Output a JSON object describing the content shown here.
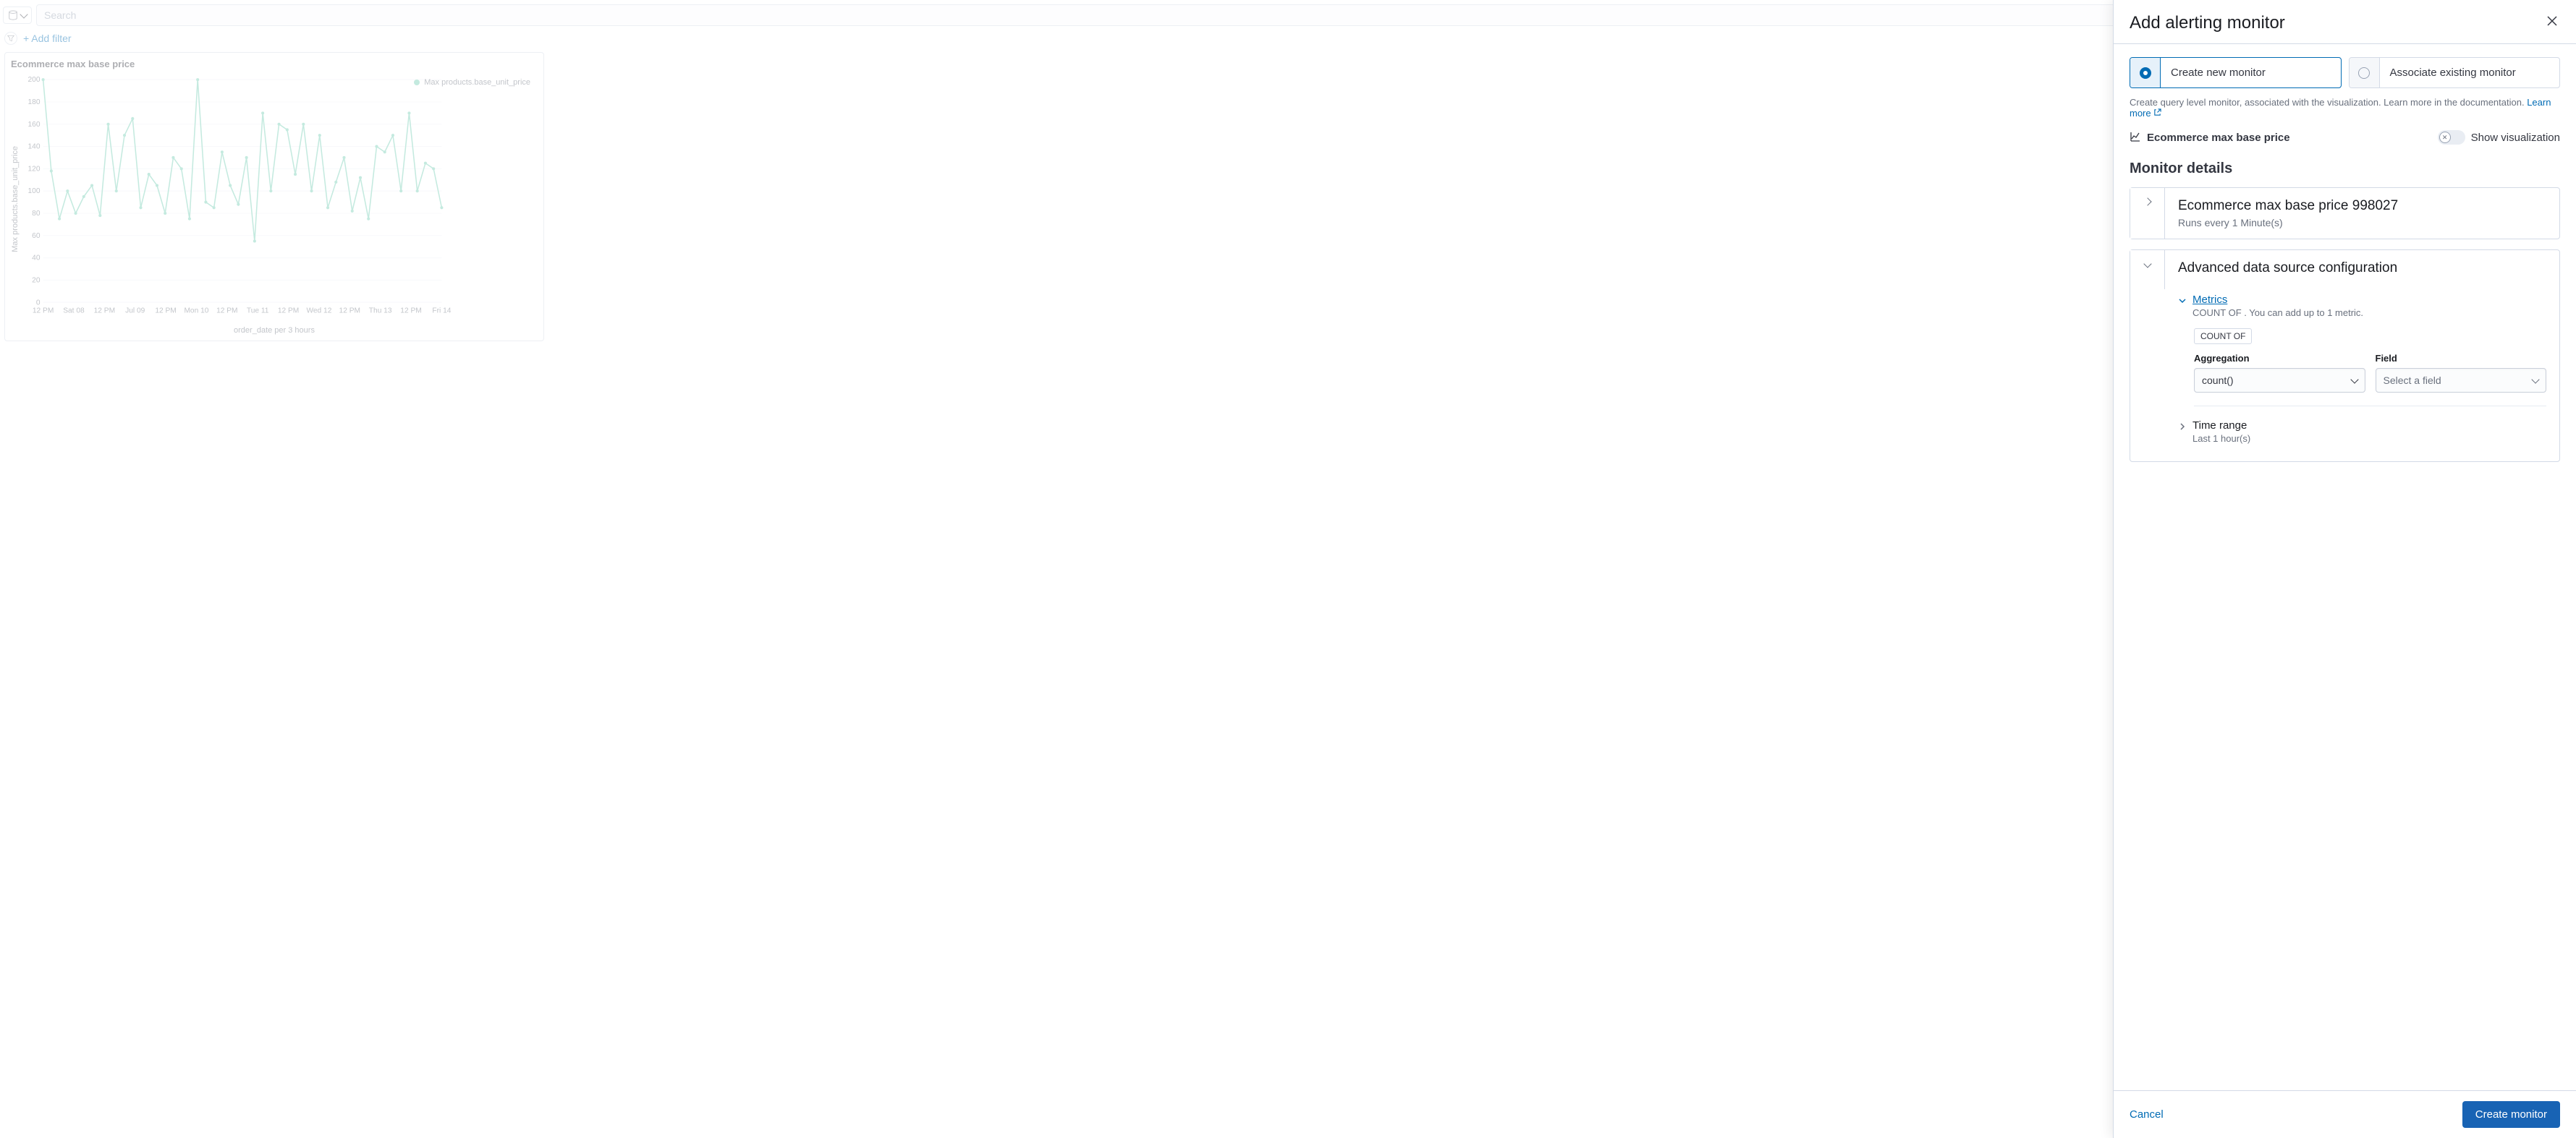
{
  "search": {
    "placeholder": "Search"
  },
  "filters": {
    "add_label": "+ Add filter"
  },
  "chart_panel": {
    "title": "Ecommerce max base price",
    "ylabel": "Max products.base_unit_price",
    "xlabel": "order_date per 3 hours",
    "legend": "Max products.base_unit_price"
  },
  "chart_data": {
    "type": "line",
    "title": "Ecommerce max base price",
    "xlabel": "order_date per 3 hours",
    "ylabel": "Max products.base_unit_price",
    "ylim": [
      0,
      200
    ],
    "y_ticks": [
      0,
      20,
      40,
      60,
      80,
      100,
      120,
      140,
      160,
      180,
      200
    ],
    "x_tick_labels": [
      "12 PM",
      "Sat 08",
      "12 PM",
      "Jul 09",
      "12 PM",
      "Mon 10",
      "12 PM",
      "Tue 11",
      "12 PM",
      "Wed 12",
      "12 PM",
      "Thu 13",
      "12 PM",
      "Fri 14"
    ],
    "series": [
      {
        "name": "Max products.base_unit_price",
        "color": "#6dccb1",
        "values": [
          200,
          118,
          75,
          100,
          80,
          95,
          105,
          78,
          160,
          100,
          150,
          165,
          85,
          115,
          105,
          80,
          130,
          120,
          75,
          200,
          90,
          85,
          135,
          105,
          88,
          130,
          55,
          170,
          100,
          160,
          155,
          115,
          160,
          100,
          150,
          85,
          108,
          130,
          82,
          112,
          75,
          140,
          135,
          150,
          100,
          170,
          100,
          125,
          120,
          85
        ]
      }
    ]
  },
  "flyout": {
    "title": "Add alerting monitor",
    "radio_create": "Create new monitor",
    "radio_associate": "Associate existing monitor",
    "helper_pre": "Create query level monitor, associated with the visualization. Learn more in the documentation. ",
    "learn_more": "Learn more",
    "viz_name": "Ecommerce max base price",
    "show_viz": "Show visualization",
    "section_monitor": "Monitor details",
    "monitor_name": "Ecommerce max base price 998027",
    "monitor_schedule": "Runs every 1 Minute(s)",
    "section_advanced": "Advanced data source configuration",
    "metrics_label": "Metrics",
    "metrics_desc": "COUNT OF . You can add up to 1 metric.",
    "badge_count": "COUNT OF",
    "agg_label": "Aggregation",
    "agg_value": "count()",
    "field_label": "Field",
    "field_placeholder": "Select a field",
    "timerange_label": "Time range",
    "timerange_desc": "Last 1 hour(s)",
    "cancel": "Cancel",
    "create": "Create monitor"
  }
}
